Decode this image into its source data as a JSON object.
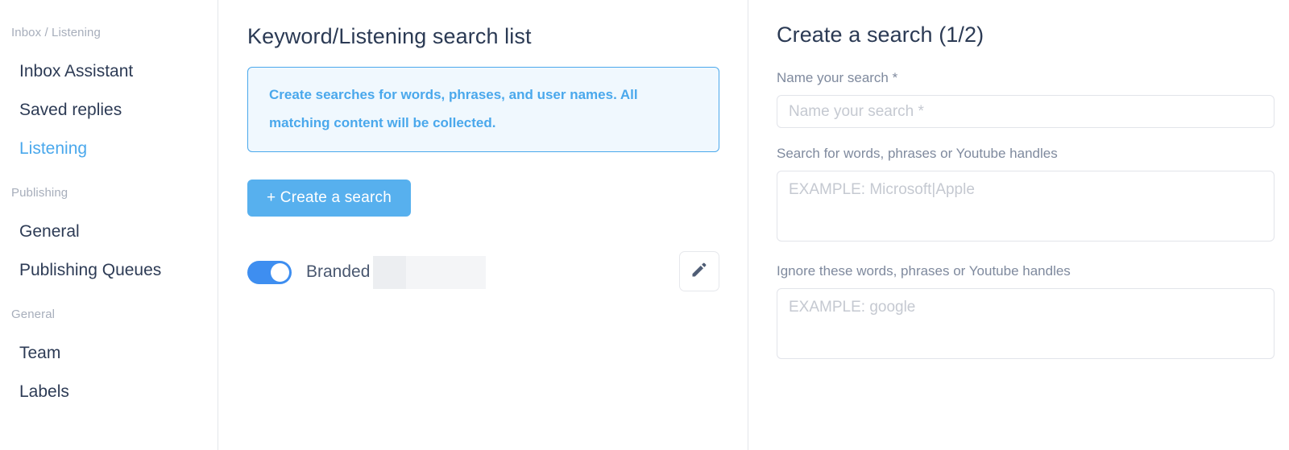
{
  "sidebar": {
    "groups": [
      {
        "label": "Inbox / Listening",
        "items": [
          {
            "label": "Inbox Assistant",
            "active": false
          },
          {
            "label": "Saved replies",
            "active": false
          },
          {
            "label": "Listening",
            "active": true
          }
        ]
      },
      {
        "label": "Publishing",
        "items": [
          {
            "label": "General",
            "active": false
          },
          {
            "label": "Publishing Queues",
            "active": false
          }
        ]
      },
      {
        "label": "General",
        "items": [
          {
            "label": "Team",
            "active": false
          },
          {
            "label": "Labels",
            "active": false
          }
        ]
      }
    ]
  },
  "middle": {
    "title": "Keyword/Listening search list",
    "info_text": "Create searches for words, phrases, and user names. All matching content will be collected.",
    "create_button": "+ Create a search",
    "search_row": {
      "toggle_state": "on",
      "name": "Branded",
      "edit_icon": "pencil-icon"
    }
  },
  "right": {
    "title": "Create a search (1/2)",
    "fields": [
      {
        "label": "Name your search *",
        "placeholder": "Name your search *",
        "value": ""
      },
      {
        "label": "Search for words, phrases or Youtube handles",
        "placeholder": "EXAMPLE: Microsoft|Apple",
        "value": ""
      },
      {
        "label": "Ignore these words, phrases or Youtube handles",
        "placeholder": "EXAMPLE: google",
        "value": ""
      }
    ]
  },
  "colors": {
    "accent_blue": "#4aa8ec",
    "button_blue": "#57b0ee",
    "toggle_blue": "#3e8ef0",
    "heading_navy": "#2b3a54",
    "muted_gray": "#a7aebb",
    "info_bg": "#f0f8fe"
  }
}
